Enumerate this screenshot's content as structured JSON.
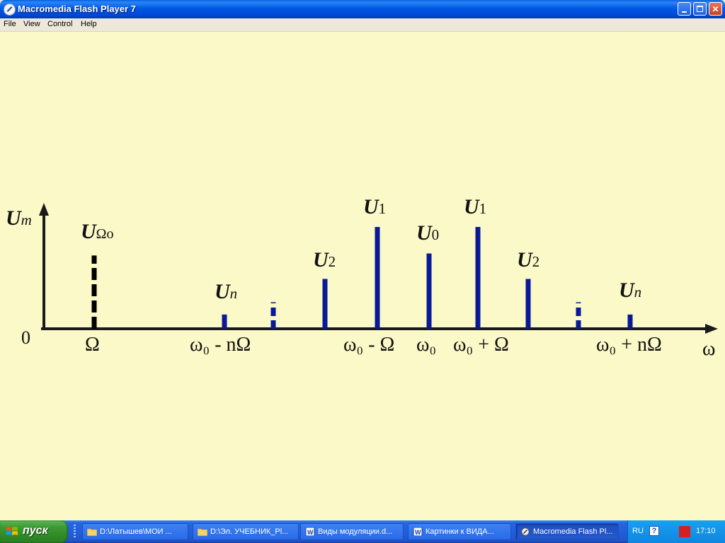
{
  "window": {
    "title": "Macromedia Flash Player 7",
    "buttons": [
      "minimize",
      "maximize",
      "close"
    ]
  },
  "menu": [
    "File",
    "View",
    "Control",
    "Help"
  ],
  "diagram": {
    "y_axis_label_main": "U",
    "y_axis_label_sub": "m",
    "x_axis_label": "ω",
    "origin_label": "0",
    "x_labels": [
      {
        "name": "x-label-omega-low",
        "text": "Ω"
      },
      {
        "name": "x-label-w0-minus-nomega",
        "text": "ω₀ - nΩ"
      },
      {
        "name": "x-label-w0-minus-omega",
        "text": "ω₀ - Ω"
      },
      {
        "name": "x-label-w0",
        "text": "ω₀"
      },
      {
        "name": "x-label-w0-plus-omega",
        "text": "ω₀ + Ω"
      },
      {
        "name": "x-label-w0-plus-nomega",
        "text": "ω₀ + nΩ"
      }
    ],
    "lines": [
      {
        "name": "line-u-omega",
        "label_main": "U",
        "label_sub": "Ωo",
        "relative_height": 0.72,
        "dashed": true
      },
      {
        "name": "line-un-left",
        "label_main": "U",
        "label_sub": "n",
        "relative_height": 0.14
      },
      {
        "name": "line-dots-left",
        "label_main": "",
        "label_sub": "",
        "relative_height": 0.26,
        "dashed": true
      },
      {
        "name": "line-u2-left",
        "label_main": "U",
        "label_sub": "2",
        "relative_height": 0.49
      },
      {
        "name": "line-u1-left",
        "label_main": "U",
        "label_sub": "1",
        "relative_height": 1.0
      },
      {
        "name": "line-u0",
        "label_main": "U",
        "label_sub": "0",
        "relative_height": 0.74
      },
      {
        "name": "line-u1-right",
        "label_main": "U",
        "label_sub": "1",
        "relative_height": 1.0
      },
      {
        "name": "line-u2-right",
        "label_main": "U",
        "label_sub": "2",
        "relative_height": 0.49
      },
      {
        "name": "line-dots-right",
        "label_main": "",
        "label_sub": "",
        "relative_height": 0.26,
        "dashed": true
      },
      {
        "name": "line-un-right",
        "label_main": "U",
        "label_sub": "n",
        "relative_height": 0.14
      }
    ],
    "colors": {
      "axis": "#1a1a1a",
      "line": "#0a1a96",
      "dashed_low": "#000000",
      "background": "#fbf9c7"
    }
  },
  "taskbar": {
    "start_label": "пуск",
    "tasks": [
      {
        "label": "D:\\Латышев\\МОИ ...",
        "icon": "folder-icon",
        "active": false
      },
      {
        "label": "D:\\Эл. УЧЕБНИК_Pl...",
        "icon": "folder-icon",
        "active": false
      },
      {
        "label": "Виды модуляции.d...",
        "icon": "word-doc-icon",
        "active": false
      },
      {
        "label": "Картинки к ВИДА...",
        "icon": "word-doc-icon",
        "active": false
      },
      {
        "label": "Macromedia Flash Pl...",
        "icon": "flash-icon",
        "active": true
      }
    ],
    "language": "RU",
    "clock": "17:10"
  }
}
